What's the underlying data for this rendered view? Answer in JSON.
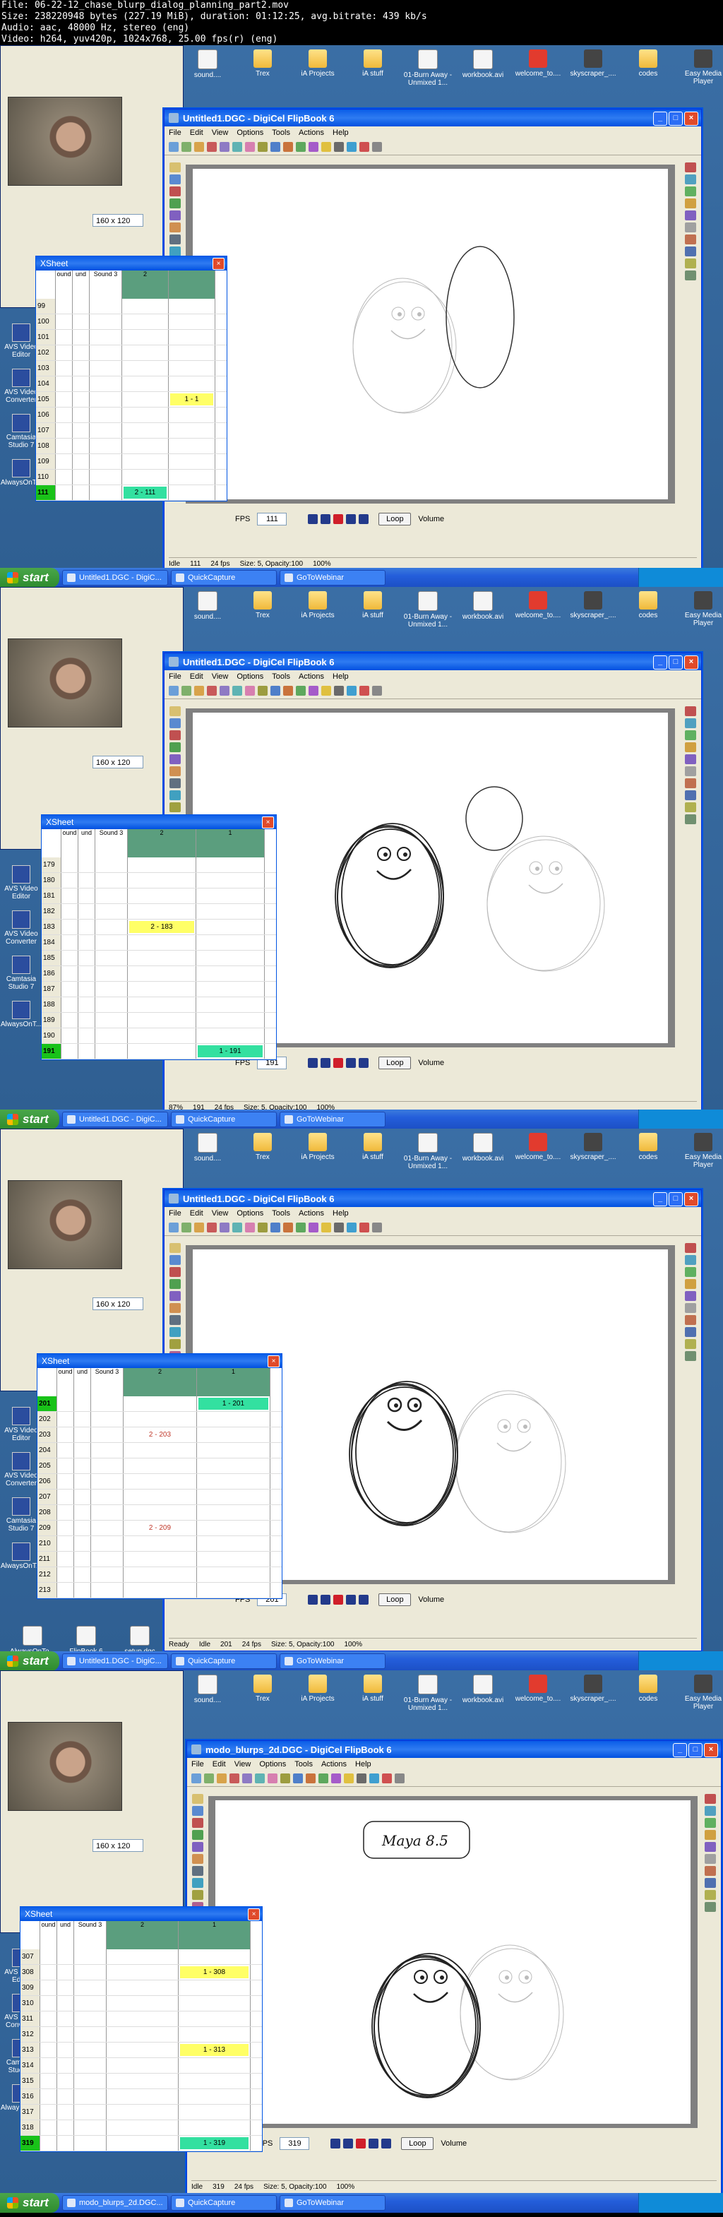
{
  "header": {
    "line1": "File: 06-22-12_chase_blurp_dialog_planning_part2.mov",
    "line2": "Size: 238220948 bytes (227.19 MiB), duration: 01:12:25, avg.bitrate: 439 kb/s",
    "line3": "Audio: aac, 48000 Hz, stereo (eng)",
    "line4": "Video: h264, yuv420p, 1024x768, 25.00 fps(r) (eng)"
  },
  "desktop_icons": [
    {
      "label": "sound....",
      "icon": "doc-icon"
    },
    {
      "label": "Trex",
      "icon": "folder-icon"
    },
    {
      "label": "iA Projects",
      "icon": "folder-icon"
    },
    {
      "label": "iA stuff",
      "icon": "folder-icon"
    },
    {
      "label": "01-Burn Away - Unmixed 1...",
      "icon": "doc-icon"
    },
    {
      "label": "workbook.avi",
      "icon": "doc-icon"
    },
    {
      "label": "welcome_to....",
      "icon": "pdf-icon"
    },
    {
      "label": "skyscraper_....",
      "icon": "media-icon"
    },
    {
      "label": "codes",
      "icon": "folder-icon"
    },
    {
      "label": "Easy Media Player",
      "icon": "media-icon"
    }
  ],
  "left_icons": [
    "AVS Video Editor",
    "AVS Video Converter",
    "Camtasia Studio 7",
    "AlwaysOnT..."
  ],
  "frames": [
    {
      "window_title": "Untitled1.DGC - DigiCel FlipBook 6",
      "menu": [
        "File",
        "Edit",
        "View",
        "Options",
        "Tools",
        "Actions",
        "Help"
      ],
      "frame_field": "111",
      "loop_label": "Loop",
      "fps_label": "FPS",
      "volume_label": "Volume",
      "status": [
        "Idle",
        "111",
        "24 fps",
        "Size: 5, Opacity:100",
        "100%"
      ],
      "webcam_size": "160 x 120",
      "xsheet": {
        "title": "XSheet",
        "col_sound": [
          "ound",
          "und",
          "Sound 3"
        ],
        "col_levels": [
          "2",
          ""
        ],
        "rows": [
          "99",
          "100",
          "101",
          "102",
          "103",
          "104",
          "105",
          "106",
          "107",
          "108",
          "109",
          "110",
          "111"
        ],
        "current_row": "111",
        "marks": [
          {
            "row": "105",
            "col": 1,
            "text": "1 - 1",
            "style": "yellow"
          },
          {
            "row": "111",
            "col": 0,
            "text": "2 - 111",
            "style": "green"
          }
        ]
      },
      "taskbar": [
        "Untitled1.DGC - DigiC...",
        "QuickCapture",
        "GoToWebinar"
      ],
      "start_label": "start"
    },
    {
      "window_title": "Untitled1.DGC - DigiCel FlipBook 6",
      "menu": [
        "File",
        "Edit",
        "View",
        "Options",
        "Tools",
        "Actions",
        "Help"
      ],
      "frame_field": "191",
      "loop_label": "Loop",
      "fps_label": "FPS",
      "volume_label": "Volume",
      "status": [
        "87%",
        "191",
        "24 fps",
        "Size: 5, Opacity:100",
        "100%"
      ],
      "webcam_size": "160 x 120",
      "xsheet": {
        "title": "XSheet",
        "col_sound": [
          "ound",
          "und",
          "Sound 3"
        ],
        "col_levels": [
          "2",
          "1"
        ],
        "rows": [
          "179",
          "180",
          "181",
          "182",
          "183",
          "184",
          "185",
          "186",
          "187",
          "188",
          "189",
          "190",
          "191"
        ],
        "current_row": "191",
        "marks": [
          {
            "row": "183",
            "col": 0,
            "text": "2 - 183",
            "style": "yellow"
          },
          {
            "row": "191",
            "col": 1,
            "text": "1 - 191",
            "style": "green"
          }
        ]
      },
      "taskbar": [
        "Untitled1.DGC - DigiC...",
        "QuickCapture",
        "GoToWebinar"
      ],
      "start_label": "start"
    },
    {
      "window_title": "Untitled1.DGC - DigiCel FlipBook 6",
      "menu": [
        "File",
        "Edit",
        "View",
        "Options",
        "Tools",
        "Actions",
        "Help"
      ],
      "frame_field": "201",
      "loop_label": "Loop",
      "fps_label": "FPS",
      "volume_label": "Volume",
      "status": [
        "Ready",
        "Idle",
        "201",
        "24 fps",
        "Size: 5, Opacity:100",
        "100%"
      ],
      "webcam_size": "160 x 120",
      "xsheet": {
        "title": "XSheet",
        "col_sound": [
          "ound",
          "und",
          "Sound 3"
        ],
        "col_levels": [
          "2",
          "1"
        ],
        "rows": [
          "201",
          "202",
          "203",
          "204",
          "205",
          "206",
          "207",
          "208",
          "209",
          "210",
          "211",
          "212",
          "213"
        ],
        "current_row": "201",
        "marks": [
          {
            "row": "201",
            "col": 1,
            "text": "1 - 201",
            "style": "green"
          },
          {
            "row": "203",
            "col": 0,
            "text": "2 - 203",
            "style": "text"
          },
          {
            "row": "209",
            "col": 0,
            "text": "2 - 209",
            "style": "text"
          }
        ]
      },
      "bottom_icons": [
        "AlwaysOnTo...",
        "FlipBook 6",
        "setup.dgc"
      ],
      "taskbar": [
        "Untitled1.DGC - DigiC...",
        "QuickCapture",
        "GoToWebinar"
      ],
      "start_label": "start"
    },
    {
      "window_title": "modo_blurps_2d.DGC - DigiCel FlipBook 6",
      "menu": [
        "File",
        "Edit",
        "View",
        "Options",
        "Tools",
        "Actions",
        "Help"
      ],
      "frame_field": "319",
      "loop_label": "Loop",
      "fps_label": "FPS",
      "volume_label": "Volume",
      "status": [
        "Idle",
        "319",
        "24 fps",
        "Size: 5, Opacity:100",
        "100%"
      ],
      "webcam_size": "160 x 120",
      "note_text": "Maya 8.5",
      "xsheet": {
        "title": "XSheet",
        "col_sound": [
          "ound",
          "und",
          "Sound 3"
        ],
        "col_levels": [
          "2",
          "1"
        ],
        "rows": [
          "307",
          "308",
          "309",
          "310",
          "311",
          "312",
          "313",
          "314",
          "315",
          "316",
          "317",
          "318",
          "319"
        ],
        "current_row": "319",
        "marks": [
          {
            "row": "308",
            "col": 1,
            "text": "1 - 308",
            "style": "yellow"
          },
          {
            "row": "313",
            "col": 1,
            "text": "1 - 313",
            "style": "yellow"
          },
          {
            "row": "319",
            "col": 1,
            "text": "1 - 319",
            "style": "green"
          }
        ]
      },
      "taskbar": [
        "modo_blurps_2d.DGC...",
        "QuickCapture",
        "GoToWebinar"
      ],
      "start_label": "start"
    }
  ]
}
